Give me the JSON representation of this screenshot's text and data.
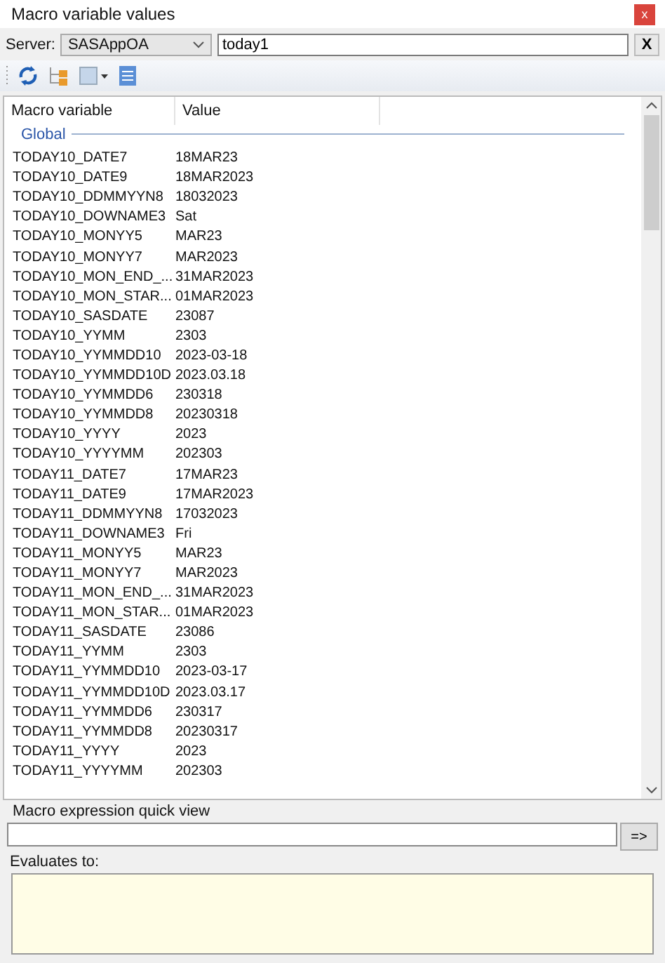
{
  "window": {
    "title": "Macro variable values",
    "close": "x"
  },
  "server": {
    "label": "Server:",
    "value": "SASAppOA",
    "filter": "today1",
    "clear": "X"
  },
  "table": {
    "columns": [
      "Macro variable",
      "Value"
    ],
    "group": "Global",
    "rows": [
      {
        "name": "TODAY10_DATE7",
        "value": "18MAR23"
      },
      {
        "name": "TODAY10_DATE9",
        "value": "18MAR2023"
      },
      {
        "name": "TODAY10_DDMMYYN8",
        "value": "18032023"
      },
      {
        "name": "TODAY10_DOWNAME3",
        "value": "Sat"
      },
      {
        "name": "TODAY10_MONYY5",
        "value": "MAR23"
      },
      {
        "name": "TODAY10_MONYY7",
        "value": "MAR2023"
      },
      {
        "name": "TODAY10_MON_END_...",
        "value": "31MAR2023"
      },
      {
        "name": "TODAY10_MON_STAR...",
        "value": "01MAR2023"
      },
      {
        "name": "TODAY10_SASDATE",
        "value": "23087"
      },
      {
        "name": "TODAY10_YYMM",
        "value": "2303"
      },
      {
        "name": "TODAY10_YYMMDD10",
        "value": "2023-03-18"
      },
      {
        "name": "TODAY10_YYMMDD10D",
        "value": "2023.03.18"
      },
      {
        "name": "TODAY10_YYMMDD6",
        "value": "230318"
      },
      {
        "name": "TODAY10_YYMMDD8",
        "value": "20230318"
      },
      {
        "name": "TODAY10_YYYY",
        "value": "2023"
      },
      {
        "name": "TODAY10_YYYYMM",
        "value": "202303"
      },
      {
        "name": "TODAY11_DATE7",
        "value": "17MAR23"
      },
      {
        "name": "TODAY11_DATE9",
        "value": "17MAR2023"
      },
      {
        "name": "TODAY11_DDMMYYN8",
        "value": "17032023"
      },
      {
        "name": "TODAY11_DOWNAME3",
        "value": "Fri"
      },
      {
        "name": "TODAY11_MONYY5",
        "value": "MAR23"
      },
      {
        "name": "TODAY11_MONYY7",
        "value": "MAR2023"
      },
      {
        "name": "TODAY11_MON_END_...",
        "value": "31MAR2023"
      },
      {
        "name": "TODAY11_MON_STAR...",
        "value": "01MAR2023"
      },
      {
        "name": "TODAY11_SASDATE",
        "value": "23086"
      },
      {
        "name": "TODAY11_YYMM",
        "value": "2303"
      },
      {
        "name": "TODAY11_YYMMDD10",
        "value": "2023-03-17"
      },
      {
        "name": "TODAY11_YYMMDD10D",
        "value": "2023.03.17"
      },
      {
        "name": "TODAY11_YYMMDD6",
        "value": "230317"
      },
      {
        "name": "TODAY11_YYMMDD8",
        "value": "20230317"
      },
      {
        "name": "TODAY11_YYYY",
        "value": "2023"
      },
      {
        "name": "TODAY11_YYYYMM",
        "value": "202303"
      }
    ]
  },
  "quick_view": {
    "title": "Macro expression quick view",
    "run": "=>",
    "result_label": "Evaluates to:"
  }
}
